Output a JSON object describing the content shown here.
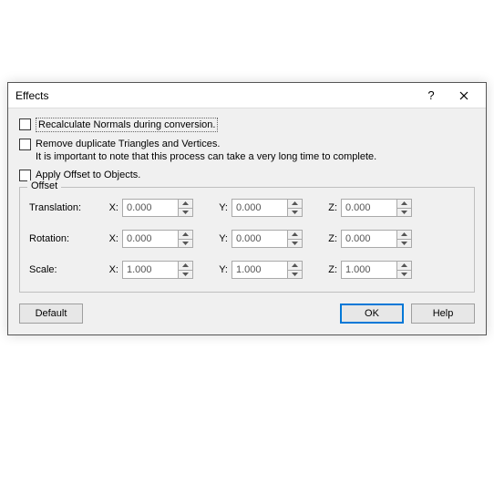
{
  "window": {
    "title": "Effects"
  },
  "checkboxes": {
    "recalc": "Recalculate Normals during conversion.",
    "removeDup_line1": "Remove duplicate Triangles and Vertices.",
    "removeDup_line2": "It is important to note that this process can take a very long time to complete.",
    "applyOffset": "Apply Offset to Objects."
  },
  "offset": {
    "legend": "Offset",
    "rows": {
      "translation": {
        "label": "Translation:",
        "x": "0.000",
        "y": "0.000",
        "z": "0.000"
      },
      "rotation": {
        "label": "Rotation:",
        "x": "0.000",
        "y": "0.000",
        "z": "0.000"
      },
      "scale": {
        "label": "Scale:",
        "x": "1.000",
        "y": "1.000",
        "z": "1.000"
      }
    },
    "axis": {
      "x": "X:",
      "y": "Y:",
      "z": "Z:"
    }
  },
  "buttons": {
    "default": "Default",
    "ok": "OK",
    "help": "Help"
  }
}
